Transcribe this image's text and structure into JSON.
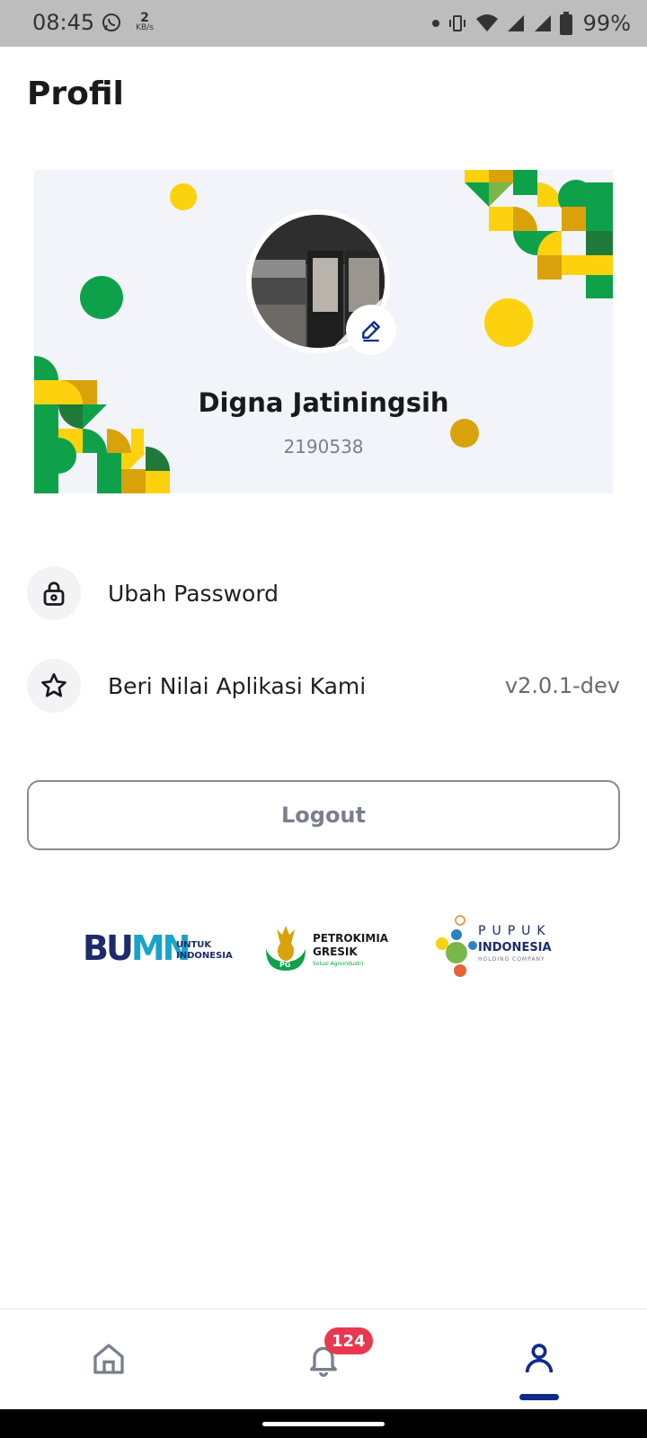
{
  "status_bar": {
    "time": "08:45",
    "net_speed_value": "2",
    "net_speed_unit": "KB/s",
    "battery": "99%"
  },
  "page": {
    "title": "Profil"
  },
  "profile": {
    "name": "Digna Jatiningsih",
    "employee_id": "2190538"
  },
  "menu": {
    "items": [
      {
        "icon": "lock-icon",
        "label": "Ubah Password"
      },
      {
        "icon": "star-icon",
        "label": "Beri Nilai Aplikasi Kami",
        "extra": "v2.0.1-dev"
      }
    ]
  },
  "logout": {
    "label": "Logout"
  },
  "logos": {
    "bumn": {
      "main": "BUMN",
      "line1": "UNTUK",
      "line2": "INDONESIA"
    },
    "petrokimia": {
      "line1": "PETROKIMIA",
      "line2": "GRESIK",
      "tagline": "Solusi Agroindustri",
      "mark": "PG"
    },
    "pupuk": {
      "line1": "PUPUK",
      "line2": "INDONESIA",
      "line3": "HOLDING COMPANY"
    }
  },
  "bottom_nav": {
    "items": [
      "home-icon",
      "bell-icon",
      "user-icon"
    ],
    "active": "profile",
    "notification_count": "124"
  },
  "colors": {
    "accent": "#0f2a8a",
    "badge": "#e8384f",
    "green": "#0ea14a",
    "yellow": "#fcd20f",
    "gold": "#d9a20b",
    "card_bg": "#f2f4fa"
  }
}
